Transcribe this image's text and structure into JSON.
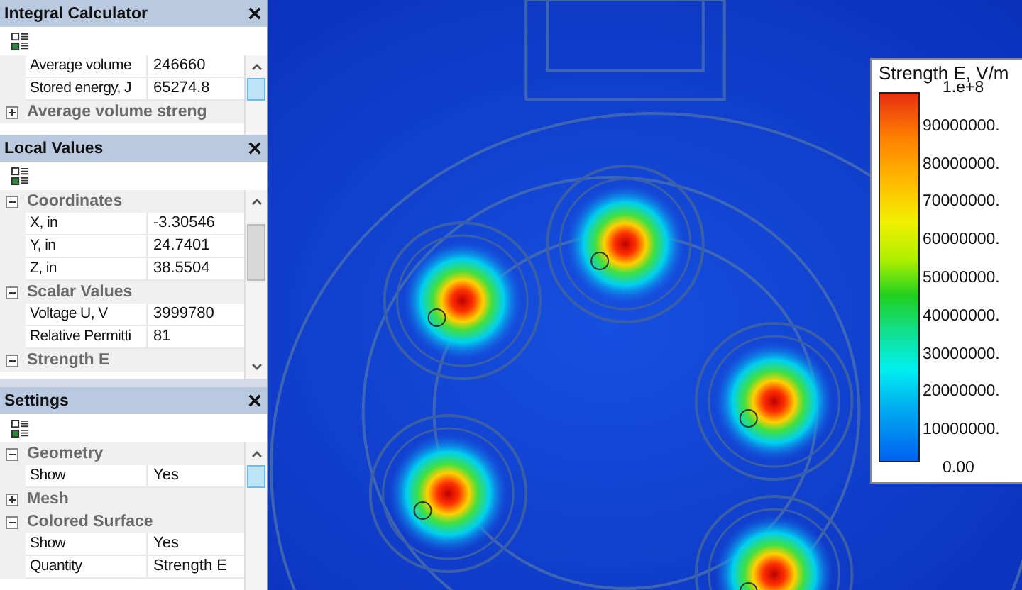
{
  "panels": [
    {
      "title": "Integral Calculator",
      "rows": [
        {
          "kind": "property",
          "name": "Average volume",
          "value": "246660"
        },
        {
          "kind": "property",
          "name": "Stored energy, J",
          "value": "65274.8"
        },
        {
          "kind": "category",
          "name": "Average volume streng",
          "expanded": false
        }
      ]
    },
    {
      "title": "Local Values",
      "rows": [
        {
          "kind": "category",
          "name": "Coordinates",
          "expanded": true
        },
        {
          "kind": "property",
          "name": "X, in",
          "value": "-3.30546"
        },
        {
          "kind": "property",
          "name": "Y, in",
          "value": "24.7401"
        },
        {
          "kind": "property",
          "name": "Z, in",
          "value": "38.5504"
        },
        {
          "kind": "category",
          "name": "Scalar Values",
          "expanded": true
        },
        {
          "kind": "property",
          "name": "Voltage U, V",
          "value": "3999780"
        },
        {
          "kind": "property",
          "name": "Relative Permitti",
          "value": "81"
        },
        {
          "kind": "category",
          "name": "Strength E",
          "expanded": true
        }
      ]
    },
    {
      "title": "Settings",
      "rows": [
        {
          "kind": "category",
          "name": "Geometry",
          "expanded": true
        },
        {
          "kind": "property",
          "name": "Show",
          "value": "Yes"
        },
        {
          "kind": "category",
          "name": "Mesh",
          "expanded": false
        },
        {
          "kind": "category",
          "name": "Colored Surface",
          "expanded": true
        },
        {
          "kind": "property",
          "name": "Show",
          "value": "Yes"
        },
        {
          "kind": "property",
          "name": "Quantity",
          "value": "Strength E"
        }
      ]
    }
  ],
  "legend": {
    "title": "Strength E, V/m",
    "labels": [
      "1.e+8",
      "90000000.",
      "80000000.",
      "70000000.",
      "60000000.",
      "50000000.",
      "40000000.",
      "30000000.",
      "20000000.",
      "10000000.",
      "0.00"
    ]
  }
}
